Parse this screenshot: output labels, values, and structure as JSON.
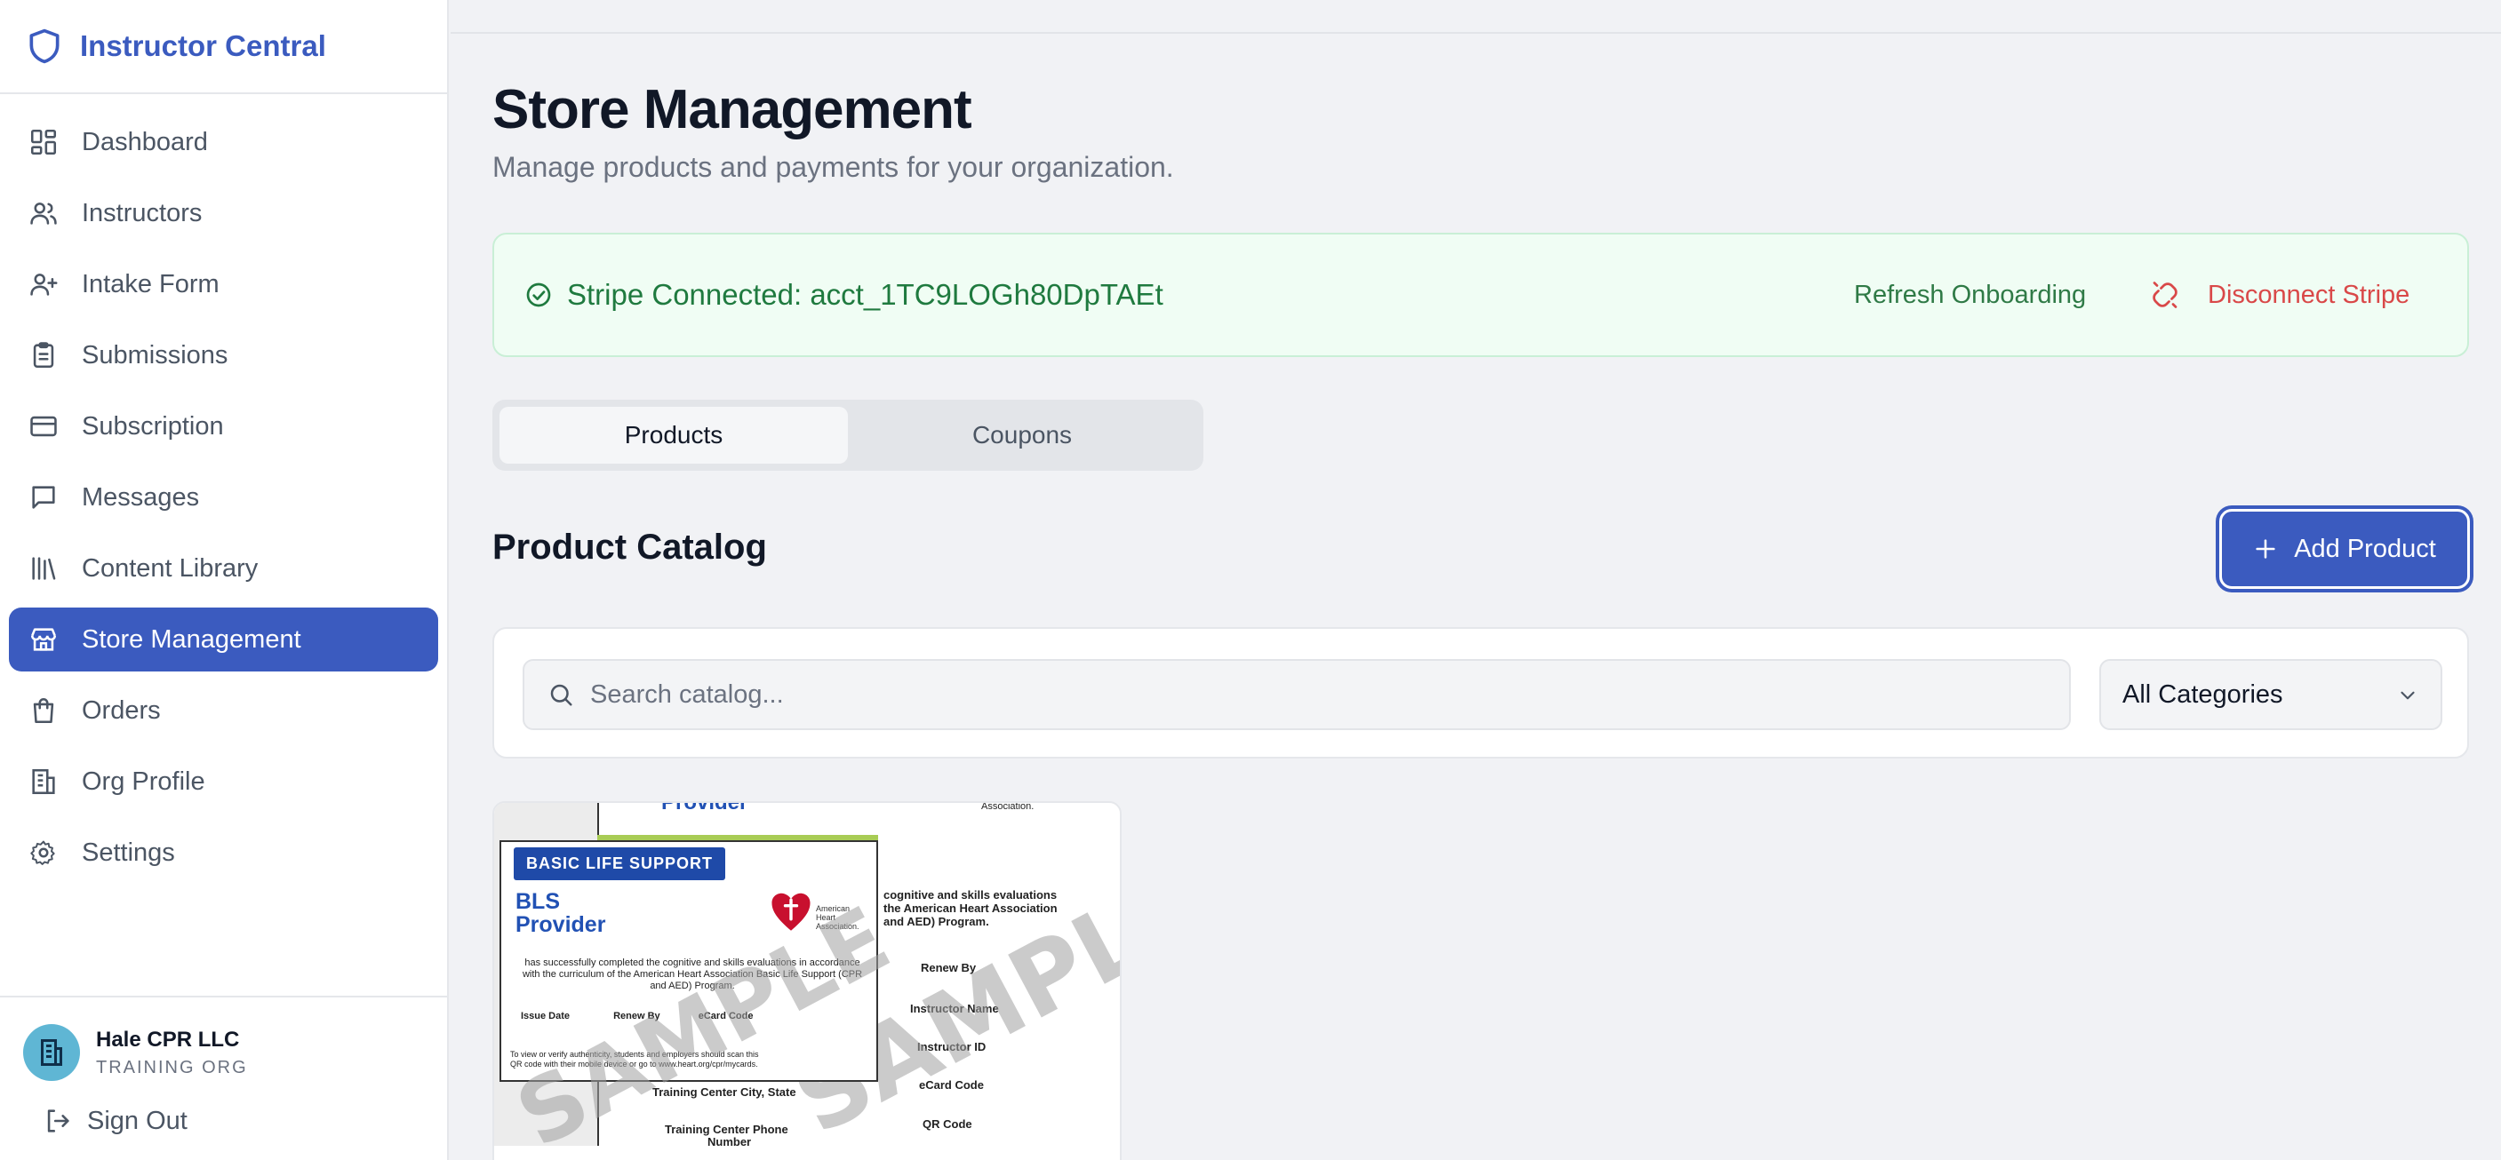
{
  "brand": {
    "title": "Instructor Central",
    "icon": "shield-icon"
  },
  "sidebar": {
    "items": [
      {
        "label": "Dashboard",
        "icon": "dashboard-icon",
        "active": false
      },
      {
        "label": "Instructors",
        "icon": "users-icon",
        "active": false
      },
      {
        "label": "Intake Form",
        "icon": "user-plus-icon",
        "active": false
      },
      {
        "label": "Submissions",
        "icon": "clipboard-icon",
        "active": false
      },
      {
        "label": "Subscription",
        "icon": "credit-card-icon",
        "active": false
      },
      {
        "label": "Messages",
        "icon": "message-icon",
        "active": false
      },
      {
        "label": "Content Library",
        "icon": "library-icon",
        "active": false
      },
      {
        "label": "Store Management",
        "icon": "store-icon",
        "active": true
      },
      {
        "label": "Orders",
        "icon": "shopping-bag-icon",
        "active": false
      },
      {
        "label": "Org Profile",
        "icon": "building-icon",
        "active": false
      },
      {
        "label": "Settings",
        "icon": "gear-icon",
        "active": false
      }
    ],
    "org": {
      "name": "Hale CPR LLC",
      "type": "TRAINING ORG"
    },
    "sign_out": "Sign Out"
  },
  "page": {
    "title": "Store Management",
    "subtitle": "Manage products and payments for your organization."
  },
  "stripe": {
    "status": "Stripe Connected: acct_1TC9LOGh80DpTAEt",
    "refresh": "Refresh Onboarding",
    "disconnect": "Disconnect Stripe"
  },
  "tabs": [
    {
      "label": "Products",
      "active": true
    },
    {
      "label": "Coupons",
      "active": false
    }
  ],
  "catalog": {
    "title": "Product Catalog",
    "add_button": "Add Product",
    "search_placeholder": "Search catalog...",
    "category_selected": "All Categories"
  },
  "product_image": {
    "band": "BASIC LIFE SUPPORT",
    "title_line1": "BLS",
    "title_line2": "Provider",
    "top_fragment": "Provider",
    "aha_line1": "American",
    "aha_line2": "Heart",
    "aha_line3": "Association.",
    "aha_top": "Association.",
    "cert_text": "has successfully completed the cognitive and skills evaluations in accordance with the curriculum of the American Heart Association Basic Life Support (CPR and AED) Program.",
    "issue_date": "Issue Date",
    "renew_by": "Renew By",
    "ecard_code": "eCard Code",
    "footer_line1": "To view or verify authenticity, students and employers should scan this",
    "footer_line2": "QR code with their mobile device or go to www.heart.org/cpr/mycards.",
    "back_line1": "cognitive and skills evaluations",
    "back_line2": "the American Heart Association",
    "back_line3": "and AED) Program.",
    "back_renew": "Renew By",
    "back_instructor_name": "Instructor Name",
    "back_instructor_id": "Instructor ID",
    "back_ecard": "eCard Code",
    "back_qr": "QR Code",
    "back_tc_city": "Training Center City, State",
    "back_tc_phone": "Training Center Phone",
    "back_number": "Number",
    "watermark": "SAMPLE"
  }
}
